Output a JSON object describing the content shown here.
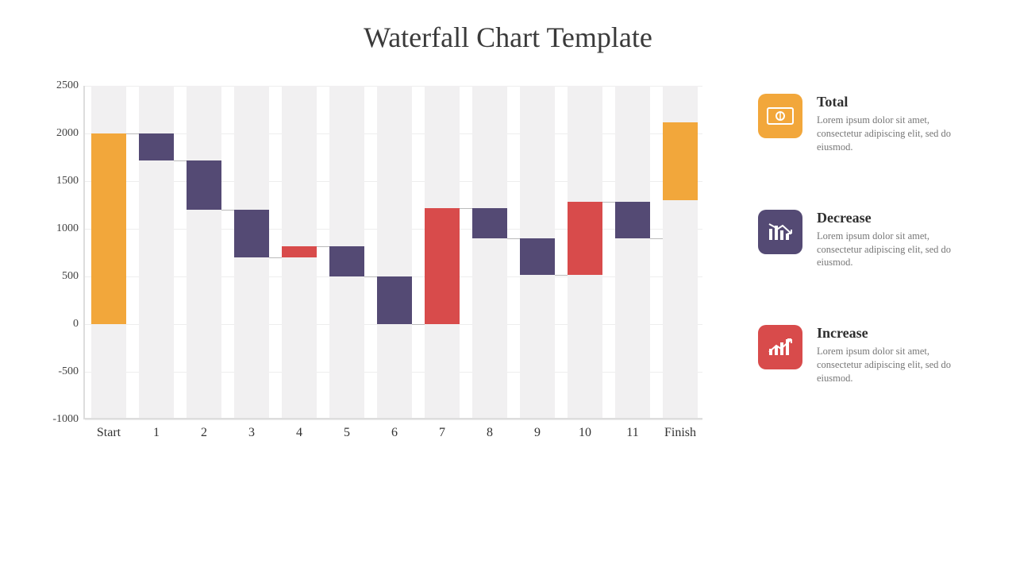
{
  "title": "Waterfall Chart Template",
  "legend": [
    {
      "key": "total",
      "title": "Total",
      "desc": "Lorem ipsum dolor sit amet, consectetur adipiscing elit, sed do eiusmod."
    },
    {
      "key": "decrease",
      "title": "Decrease",
      "desc": "Lorem ipsum dolor sit amet, consectetur adipiscing elit, sed do eiusmod."
    },
    {
      "key": "increase",
      "title": "Increase",
      "desc": "Lorem ipsum dolor sit amet, consectetur adipiscing elit, sed do eiusmod."
    }
  ],
  "chart_data": {
    "type": "waterfall",
    "xlabel": "",
    "ylabel": "",
    "ylim": [
      -1000,
      2500
    ],
    "yticks": [
      -1000,
      -500,
      0,
      500,
      1000,
      1500,
      2000,
      2500
    ],
    "categories": [
      "Start",
      "1",
      "2",
      "3",
      "4",
      "5",
      "6",
      "7",
      "8",
      "9",
      "10",
      "11",
      "Finish"
    ],
    "series": [
      {
        "label": "Start",
        "kind": "total",
        "delta": 2000,
        "base": 0,
        "top": 2000
      },
      {
        "label": "1",
        "kind": "decrease",
        "delta": -280,
        "base": 1720,
        "top": 2000
      },
      {
        "label": "2",
        "kind": "decrease",
        "delta": -520,
        "base": 1200,
        "top": 1720
      },
      {
        "label": "3",
        "kind": "decrease",
        "delta": -500,
        "base": 700,
        "top": 1200
      },
      {
        "label": "4",
        "kind": "increase",
        "delta": 120,
        "base": 700,
        "top": 820
      },
      {
        "label": "5",
        "kind": "decrease",
        "delta": -320,
        "base": 500,
        "top": 820
      },
      {
        "label": "6",
        "kind": "decrease",
        "delta": -500,
        "base": 0,
        "top": 500
      },
      {
        "label": "7",
        "kind": "increase",
        "delta": 1220,
        "base": 0,
        "top": 1220
      },
      {
        "label": "8",
        "kind": "decrease",
        "delta": -320,
        "base": 900,
        "top": 1220
      },
      {
        "label": "9",
        "kind": "decrease",
        "delta": -380,
        "base": 520,
        "top": 900
      },
      {
        "label": "10",
        "kind": "increase",
        "delta": 760,
        "base": 520,
        "top": 1280
      },
      {
        "label": "11",
        "kind": "decrease",
        "delta": -380,
        "base": 900,
        "top": 1280
      },
      {
        "label": "Finish",
        "kind": "total",
        "delta": 820,
        "base": 1300,
        "top": 2120
      }
    ],
    "colors": {
      "total": "#F2A73B",
      "decrease": "#544A74",
      "increase": "#D84B4B"
    }
  }
}
